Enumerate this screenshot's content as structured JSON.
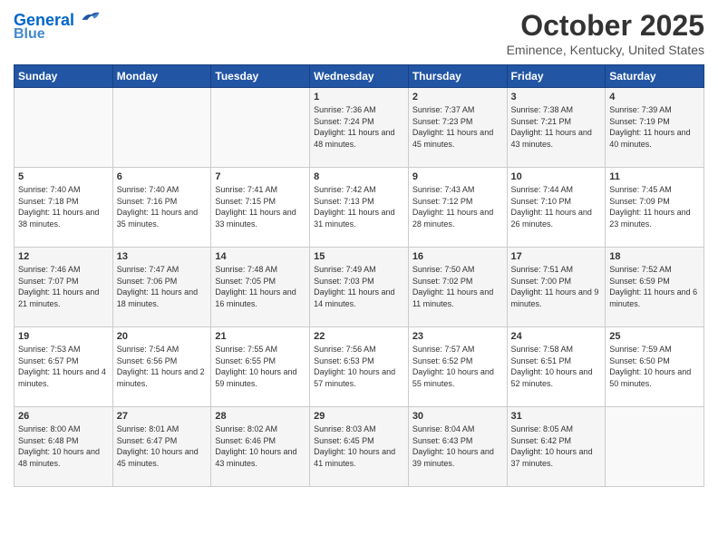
{
  "header": {
    "logo_line1": "General",
    "logo_line2": "Blue",
    "month": "October 2025",
    "location": "Eminence, Kentucky, United States"
  },
  "weekdays": [
    "Sunday",
    "Monday",
    "Tuesday",
    "Wednesday",
    "Thursday",
    "Friday",
    "Saturday"
  ],
  "weeks": [
    [
      {
        "day": "",
        "info": ""
      },
      {
        "day": "",
        "info": ""
      },
      {
        "day": "",
        "info": ""
      },
      {
        "day": "1",
        "info": "Sunrise: 7:36 AM\nSunset: 7:24 PM\nDaylight: 11 hours and 48 minutes."
      },
      {
        "day": "2",
        "info": "Sunrise: 7:37 AM\nSunset: 7:23 PM\nDaylight: 11 hours and 45 minutes."
      },
      {
        "day": "3",
        "info": "Sunrise: 7:38 AM\nSunset: 7:21 PM\nDaylight: 11 hours and 43 minutes."
      },
      {
        "day": "4",
        "info": "Sunrise: 7:39 AM\nSunset: 7:19 PM\nDaylight: 11 hours and 40 minutes."
      }
    ],
    [
      {
        "day": "5",
        "info": "Sunrise: 7:40 AM\nSunset: 7:18 PM\nDaylight: 11 hours and 38 minutes."
      },
      {
        "day": "6",
        "info": "Sunrise: 7:40 AM\nSunset: 7:16 PM\nDaylight: 11 hours and 35 minutes."
      },
      {
        "day": "7",
        "info": "Sunrise: 7:41 AM\nSunset: 7:15 PM\nDaylight: 11 hours and 33 minutes."
      },
      {
        "day": "8",
        "info": "Sunrise: 7:42 AM\nSunset: 7:13 PM\nDaylight: 11 hours and 31 minutes."
      },
      {
        "day": "9",
        "info": "Sunrise: 7:43 AM\nSunset: 7:12 PM\nDaylight: 11 hours and 28 minutes."
      },
      {
        "day": "10",
        "info": "Sunrise: 7:44 AM\nSunset: 7:10 PM\nDaylight: 11 hours and 26 minutes."
      },
      {
        "day": "11",
        "info": "Sunrise: 7:45 AM\nSunset: 7:09 PM\nDaylight: 11 hours and 23 minutes."
      }
    ],
    [
      {
        "day": "12",
        "info": "Sunrise: 7:46 AM\nSunset: 7:07 PM\nDaylight: 11 hours and 21 minutes."
      },
      {
        "day": "13",
        "info": "Sunrise: 7:47 AM\nSunset: 7:06 PM\nDaylight: 11 hours and 18 minutes."
      },
      {
        "day": "14",
        "info": "Sunrise: 7:48 AM\nSunset: 7:05 PM\nDaylight: 11 hours and 16 minutes."
      },
      {
        "day": "15",
        "info": "Sunrise: 7:49 AM\nSunset: 7:03 PM\nDaylight: 11 hours and 14 minutes."
      },
      {
        "day": "16",
        "info": "Sunrise: 7:50 AM\nSunset: 7:02 PM\nDaylight: 11 hours and 11 minutes."
      },
      {
        "day": "17",
        "info": "Sunrise: 7:51 AM\nSunset: 7:00 PM\nDaylight: 11 hours and 9 minutes."
      },
      {
        "day": "18",
        "info": "Sunrise: 7:52 AM\nSunset: 6:59 PM\nDaylight: 11 hours and 6 minutes."
      }
    ],
    [
      {
        "day": "19",
        "info": "Sunrise: 7:53 AM\nSunset: 6:57 PM\nDaylight: 11 hours and 4 minutes."
      },
      {
        "day": "20",
        "info": "Sunrise: 7:54 AM\nSunset: 6:56 PM\nDaylight: 11 hours and 2 minutes."
      },
      {
        "day": "21",
        "info": "Sunrise: 7:55 AM\nSunset: 6:55 PM\nDaylight: 10 hours and 59 minutes."
      },
      {
        "day": "22",
        "info": "Sunrise: 7:56 AM\nSunset: 6:53 PM\nDaylight: 10 hours and 57 minutes."
      },
      {
        "day": "23",
        "info": "Sunrise: 7:57 AM\nSunset: 6:52 PM\nDaylight: 10 hours and 55 minutes."
      },
      {
        "day": "24",
        "info": "Sunrise: 7:58 AM\nSunset: 6:51 PM\nDaylight: 10 hours and 52 minutes."
      },
      {
        "day": "25",
        "info": "Sunrise: 7:59 AM\nSunset: 6:50 PM\nDaylight: 10 hours and 50 minutes."
      }
    ],
    [
      {
        "day": "26",
        "info": "Sunrise: 8:00 AM\nSunset: 6:48 PM\nDaylight: 10 hours and 48 minutes."
      },
      {
        "day": "27",
        "info": "Sunrise: 8:01 AM\nSunset: 6:47 PM\nDaylight: 10 hours and 45 minutes."
      },
      {
        "day": "28",
        "info": "Sunrise: 8:02 AM\nSunset: 6:46 PM\nDaylight: 10 hours and 43 minutes."
      },
      {
        "day": "29",
        "info": "Sunrise: 8:03 AM\nSunset: 6:45 PM\nDaylight: 10 hours and 41 minutes."
      },
      {
        "day": "30",
        "info": "Sunrise: 8:04 AM\nSunset: 6:43 PM\nDaylight: 10 hours and 39 minutes."
      },
      {
        "day": "31",
        "info": "Sunrise: 8:05 AM\nSunset: 6:42 PM\nDaylight: 10 hours and 37 minutes."
      },
      {
        "day": "",
        "info": ""
      }
    ]
  ]
}
